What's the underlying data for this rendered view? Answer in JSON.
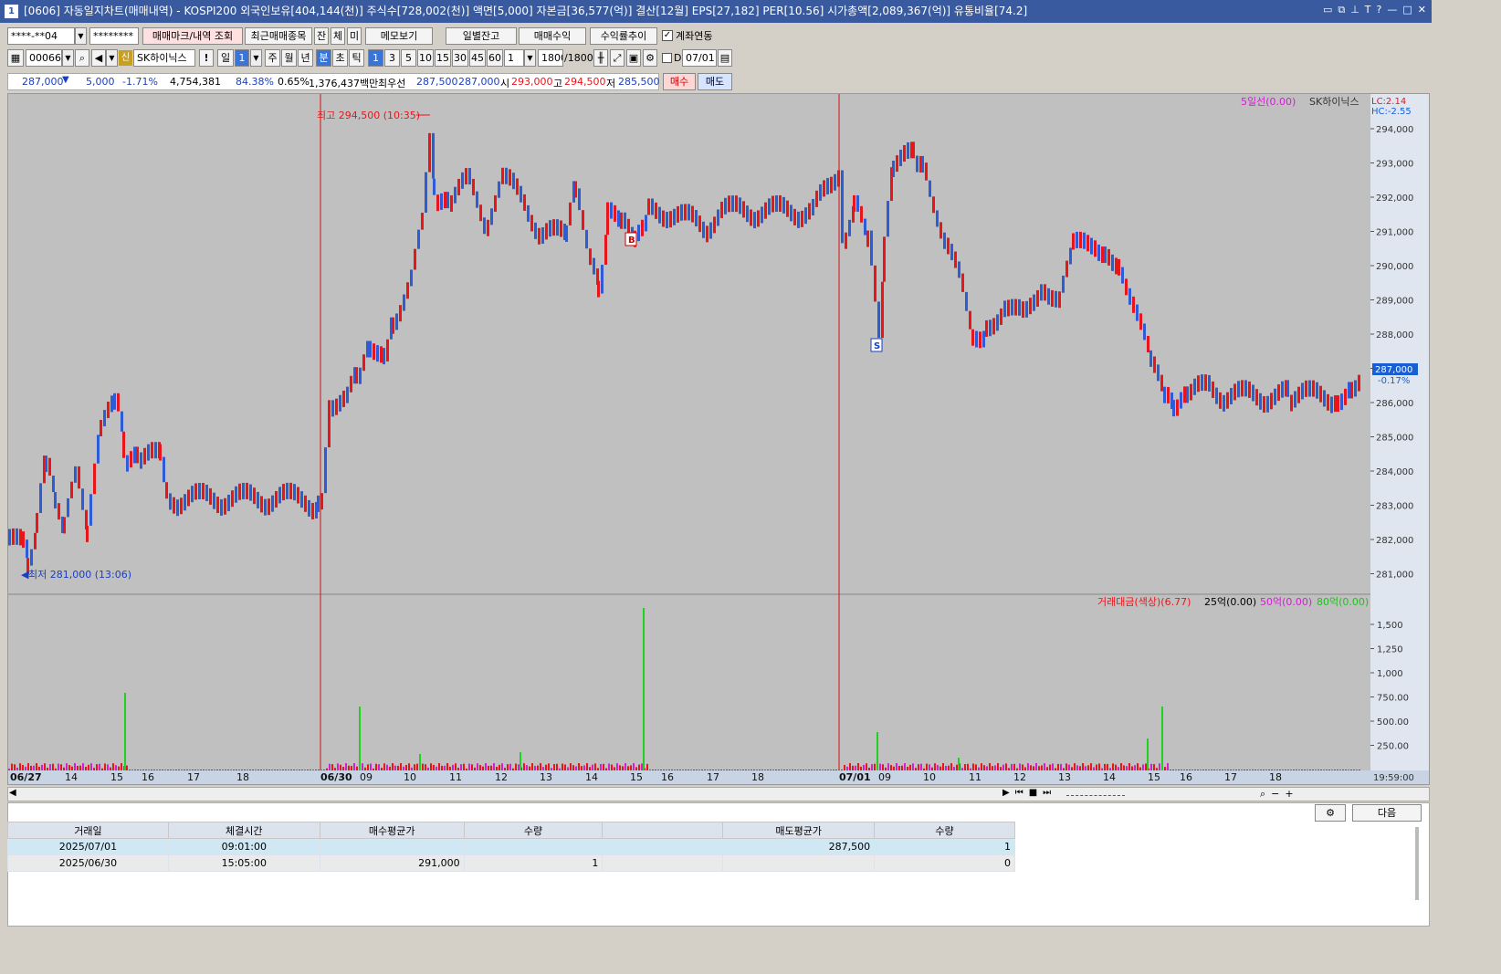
{
  "window": {
    "title": "[0606] 자동일지차트(매매내역) - KOSPI200 외국인보유[404,144(천)] 주식수[728,002(천)] 액면[5,000] 자본금[36,577(억)] 결산[12월] EPS[27,182] PER[10.56] 시가총액[2,089,367(억)] 유통비율[74.2]",
    "icon": "1"
  },
  "toolbar1": {
    "account": "****-**04",
    "password": "********",
    "btn_trade_mark": "매매마크/내역 조회",
    "btn_recent": "최근매매종목",
    "btn_jan": "잔",
    "btn_che": "체",
    "btn_mi": "미",
    "btn_memo": "메모보기",
    "btn_daily_balance": "일별잔고",
    "btn_trade_profit": "매매수익",
    "btn_return_trend": "수익률추이",
    "link_label": "계좌연동"
  },
  "toolbar2": {
    "code": "000660",
    "sin_badge": "신",
    "stock_name": "SK하이닉스",
    "excl": "!",
    "day": "일",
    "day_val": "1",
    "periods": [
      "주",
      "월",
      "년",
      "분",
      "초",
      "틱"
    ],
    "minute_options": [
      "1",
      "3",
      "5",
      "10",
      "15",
      "30",
      "45",
      "60"
    ],
    "sel_count": "1",
    "count_display": "1800",
    "count_total": "/1800",
    "d_label": "D",
    "date": "07/01"
  },
  "quote": {
    "price": "287,000",
    "change": "5,000",
    "rate": "-1.71%",
    "volume": "4,754,381",
    "vol_pct": "84.38%",
    "turnover_pct": "0.65%",
    "amount": "1,376,437백만",
    "best_label": "최우선",
    "ask": "287,500",
    "bid": "287,000",
    "open_label": "시",
    "open": "293,000",
    "high_label": "고",
    "high": "294,500",
    "low_label": "저",
    "low": "285,500",
    "buy_btn": "매수",
    "sell_btn": "매도"
  },
  "price_chart": {
    "legend_ma": "5일선(0.00)",
    "legend_stock": "SK하이닉스",
    "lc": "LC:2.14",
    "hc": "HC:-2.55",
    "y_ticks": [
      "294,000",
      "293,000",
      "292,000",
      "291,000",
      "290,000",
      "289,000",
      "288,000",
      "287,000",
      "286,000",
      "285,000",
      "284,000",
      "283,000",
      "282,000",
      "281,000"
    ],
    "current_label": "287,000",
    "current_pct": "-0.17%",
    "high_annot": "최고 294,500 (10:35)",
    "low_annot": "최저 281,000 (13:06)",
    "buy_marker": "B",
    "sell_marker": "S"
  },
  "volume_chart": {
    "legend_amount": "거래대금(색상)(6.77)",
    "legend_25": "25억(0.00)",
    "legend_50": "50억(0.00)",
    "legend_80": "80억(0.00)",
    "y_ticks": [
      "1,500",
      "1,250",
      "1,000",
      "750.00",
      "500.00",
      "250.00"
    ]
  },
  "x_axis": {
    "labels": [
      "06/27",
      "14",
      "15",
      "16",
      "17",
      "18",
      "06/30",
      "09",
      "10",
      "11",
      "12",
      "13",
      "14",
      "15",
      "16",
      "17",
      "18",
      "07/01",
      "09",
      "10",
      "11",
      "12",
      "13",
      "14",
      "15",
      "16",
      "17",
      "18"
    ],
    "end_time": "19:59:00"
  },
  "bottom": {
    "next_btn": "다음",
    "columns": [
      "거래일",
      "체결시간",
      "매수평균가",
      "수량",
      "",
      "매도평균가",
      "수량"
    ],
    "rows": [
      {
        "date": "2025/07/01",
        "time": "09:01:00",
        "buy_avg": "",
        "buy_qty": "",
        "blank": "",
        "sell_avg": "287,500",
        "sell_qty": "1"
      },
      {
        "date": "2025/06/30",
        "time": "15:05:00",
        "buy_avg": "291,000",
        "buy_qty": "1",
        "blank": "",
        "sell_avg": "",
        "sell_qty": "0"
      }
    ]
  },
  "colors": {
    "up": "#e8161a",
    "down": "#2e5bd6",
    "plot_bg": "#c0c0c0",
    "title_bg": "#3a5a9f"
  }
}
